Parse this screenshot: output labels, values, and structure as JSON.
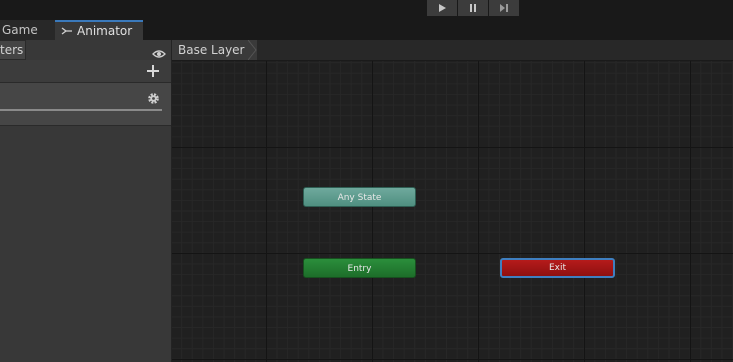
{
  "toolbar": {
    "play_icon": "play-icon",
    "pause_icon": "pause-icon",
    "step_icon": "step-icon"
  },
  "tabs": {
    "game_label": "Game",
    "animator_label": "Animator",
    "animator_icon": "animator-icon"
  },
  "left_panel": {
    "parameters_tab_label": "ters",
    "eye_icon": "eye-icon",
    "add_icon": "plus-icon",
    "gear_icon": "gear-icon"
  },
  "breadcrumb": {
    "layer_label": "Base Layer"
  },
  "graph": {
    "nodes": {
      "any_state": "Any State",
      "entry": "Entry",
      "exit": "Exit"
    }
  },
  "colors": {
    "accent": "#3a79bb",
    "any_state": "#5f9e90",
    "entry": "#247d33",
    "exit": "#a31515"
  }
}
